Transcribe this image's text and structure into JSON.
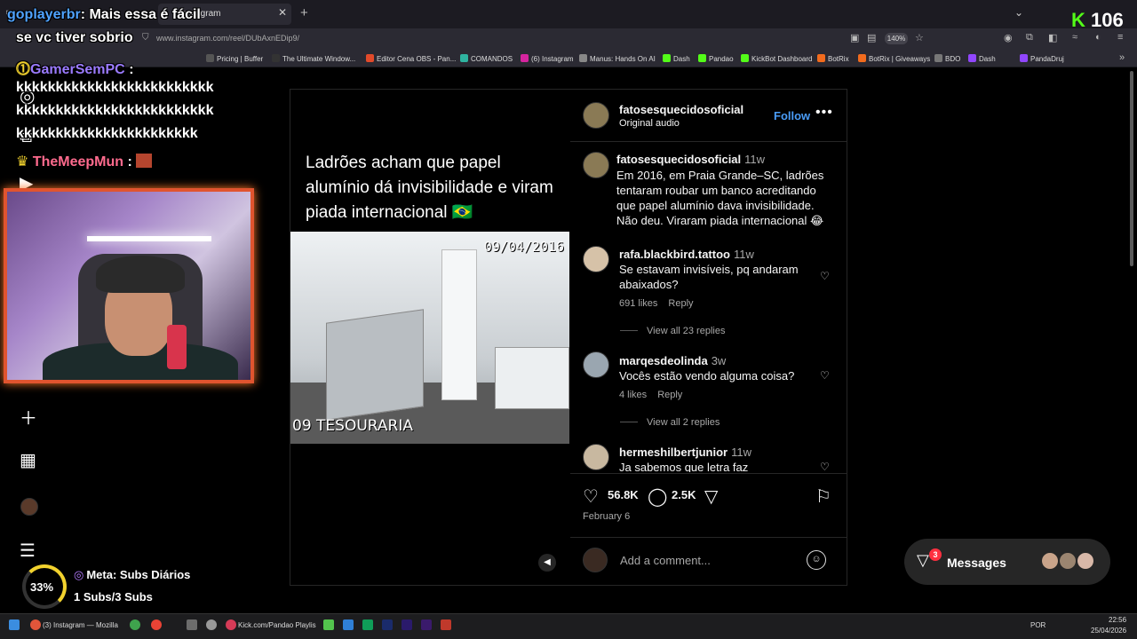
{
  "browser": {
    "tab_title": "Instagram",
    "url": "www.instagram.com/reel/DUbAxnEDip9/",
    "zoom": "140%",
    "bookmarks": [
      {
        "label": "Pricing | Buffer",
        "color": "#555"
      },
      {
        "label": "The Ultimate Window...",
        "color": "#333"
      },
      {
        "label": "Editor Cena OBS - Pan...",
        "color": "#e24a2a"
      },
      {
        "label": "COMANDOS",
        "color": "#2fb3a0"
      },
      {
        "label": "(6) Instagram",
        "color": "#d6249f"
      },
      {
        "label": "Manus: Hands On AI",
        "color": "#888"
      },
      {
        "label": "Dash",
        "color": "#53fc18"
      },
      {
        "label": "Pandao",
        "color": "#53fc18"
      },
      {
        "label": "KickBot Dashboard",
        "color": "#53fc18"
      },
      {
        "label": "BotRix",
        "color": "#f26b1d"
      },
      {
        "label": "BotRix | Giveaways",
        "color": "#f26b1d"
      },
      {
        "label": "BDO",
        "color": "#777"
      },
      {
        "label": "Dash",
        "color": "#9146ff"
      },
      {
        "label": "PandaDruj",
        "color": "#9146ff"
      }
    ]
  },
  "chat": {
    "line1_user": "goplayerbr",
    "line1_msg": ": Mais essa é fácil",
    "line2": "se vc tiver sobrio",
    "line3_user": "GamerSemPC",
    "line3_sep": ":",
    "line4": "kkkkkkkkkkkkkkkkkkkkkkkkk",
    "line5": "kkkkkkkkkkkkkkkkkkkkkkkkk",
    "line6": "kkkkkkkkkkkkkkkkkkkkkkk",
    "line7_user": "TheMeepMun",
    "line7_sep": ":"
  },
  "post": {
    "video_caption": "Ladrões acham que papel alumínio dá invisibilidade e viram piada internacional 🇧🇷",
    "video_date": "09/04/2016",
    "video_label": "09 TESOURARIA",
    "author": "fatosesquecidosoficial",
    "audio": "Original audio",
    "follow_label": "Follow",
    "caption_time": "11w",
    "caption_text": "Em 2016, em Praia Grande–SC, ladrões tentaram roubar um banco acreditando que papel alumínio dava invisibilidade. Não deu. Viraram piada internacional 😂",
    "comments": [
      {
        "user": "rafa.blackbird.tattoo",
        "time": "11w",
        "text": "Se estavam invisíveis, pq andaram abaixados?",
        "likes": "691 likes",
        "reply": "Reply",
        "view_replies": "View all 23 replies"
      },
      {
        "user": "marqesdeolinda",
        "time": "3w",
        "text": "Vocês estão vendo alguma coisa?",
        "likes": "4 likes",
        "reply": "Reply",
        "view_replies": "View all 2 replies"
      },
      {
        "user": "hermeshilbertjunior",
        "time": "11w",
        "text": "Ja sabemos que letra faz"
      }
    ],
    "like_count": "56.8K",
    "comment_count": "2.5K",
    "date": "February 6",
    "add_comment_placeholder": "Add a comment..."
  },
  "messages": {
    "label": "Messages",
    "badge": "3"
  },
  "overlay": {
    "kick_count": "106",
    "meta_percent": "33%",
    "meta_title": "Meta: Subs Diários",
    "meta_progress": "1 Subs/3 Subs"
  },
  "taskbar": {
    "firefox_label": "(3) Instagram — Mozilla",
    "kick_label": "Kick.com/Pandao Playlis",
    "lang": "POR",
    "time": "22:56",
    "date": "25/04/2026"
  },
  "colors": {
    "follow": "#4a9df8",
    "kick_green": "#53fc18",
    "webcam_border": "#e0542f"
  }
}
